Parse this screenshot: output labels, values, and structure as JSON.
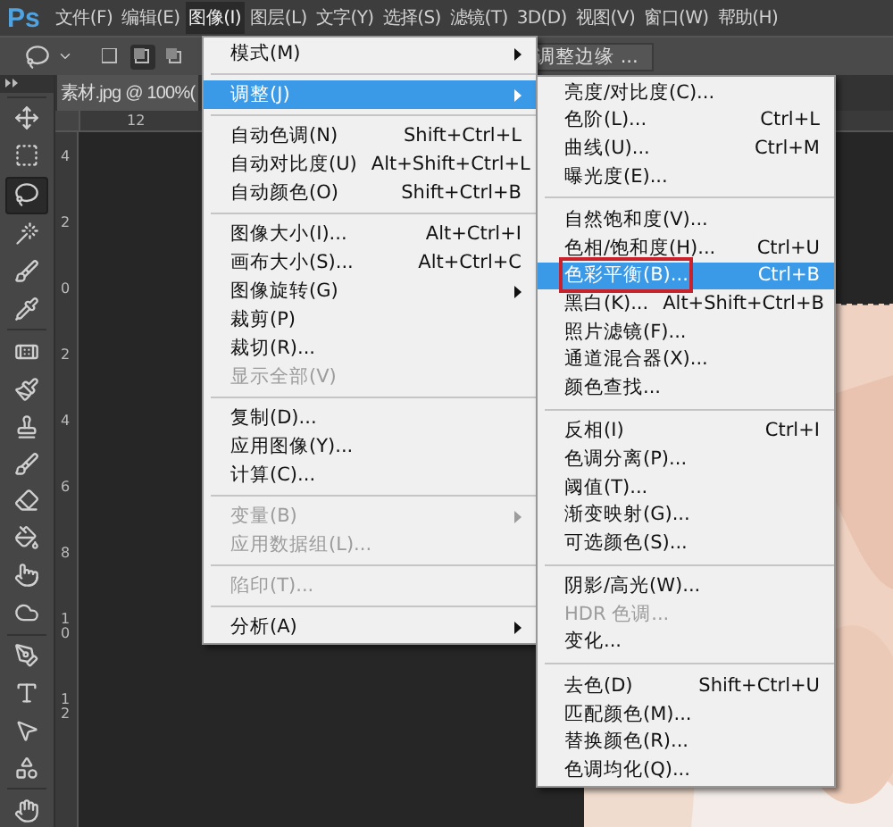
{
  "app_logo": "Ps",
  "menu_bar": [
    {
      "label": "文件(F)",
      "selected": false
    },
    {
      "label": "编辑(E)",
      "selected": false
    },
    {
      "label": "图像(I)",
      "selected": true
    },
    {
      "label": "图层(L)",
      "selected": false
    },
    {
      "label": "文字(Y)",
      "selected": false
    },
    {
      "label": "选择(S)",
      "selected": false
    },
    {
      "label": "滤镜(T)",
      "selected": false
    },
    {
      "label": "3D(D)",
      "selected": false
    },
    {
      "label": "视图(V)",
      "selected": false
    },
    {
      "label": "窗口(W)",
      "selected": false
    },
    {
      "label": "帮助(H)",
      "selected": false
    }
  ],
  "options_bar": {
    "selection_modes": [
      {
        "selected": false
      },
      {
        "selected": true
      },
      {
        "selected": false
      }
    ],
    "refine_edge_button": "调整边缘 ..."
  },
  "document_tab": "素材.jpg @ 100%(",
  "top_ruler": [
    "12"
  ],
  "left_ruler": [
    "4",
    "2",
    "0",
    "2",
    "4",
    "6",
    "8",
    "10",
    "12"
  ],
  "tools": [
    {
      "kind": "move",
      "selected": false
    },
    {
      "kind": "marquee",
      "selected": false
    },
    {
      "kind": "lasso",
      "selected": true
    },
    {
      "kind": "wand",
      "selected": false
    },
    {
      "kind": "quick",
      "selected": false
    },
    {
      "kind": "eyedropper",
      "selected": false
    },
    {
      "kind": "heal",
      "selected": false
    },
    {
      "kind": "brush",
      "selected": false
    },
    {
      "kind": "stamp",
      "selected": false
    },
    {
      "kind": "history",
      "selected": false
    },
    {
      "kind": "eraser",
      "selected": false
    },
    {
      "kind": "bucket",
      "selected": false
    },
    {
      "kind": "smudge",
      "selected": false
    },
    {
      "kind": "sponge",
      "selected": false
    },
    {
      "kind": "pen",
      "selected": false
    },
    {
      "kind": "type",
      "selected": false
    },
    {
      "kind": "path",
      "selected": false
    },
    {
      "kind": "shape",
      "selected": false
    },
    {
      "kind": "hand",
      "selected": false
    }
  ],
  "image_menu": [
    {
      "kind": "item",
      "label": "模式(M)",
      "has_submenu": true,
      "selected": false,
      "disabled": false
    },
    {
      "kind": "separator"
    },
    {
      "kind": "item",
      "label": "调整(J)",
      "has_submenu": true,
      "selected": true,
      "disabled": false
    },
    {
      "kind": "separator"
    },
    {
      "kind": "item",
      "label": "自动色调(N)",
      "shortcut": "Shift+Ctrl+L",
      "selected": false,
      "disabled": false
    },
    {
      "kind": "item",
      "label": "自动对比度(U)",
      "shortcut": "Alt+Shift+Ctrl+L",
      "selected": false,
      "disabled": false
    },
    {
      "kind": "item",
      "label": "自动颜色(O)",
      "shortcut": "Shift+Ctrl+B",
      "selected": false,
      "disabled": false
    },
    {
      "kind": "separator"
    },
    {
      "kind": "item",
      "label": "图像大小(I)...",
      "shortcut": "Alt+Ctrl+I",
      "selected": false,
      "disabled": false
    },
    {
      "kind": "item",
      "label": "画布大小(S)...",
      "shortcut": "Alt+Ctrl+C",
      "selected": false,
      "disabled": false
    },
    {
      "kind": "item",
      "label": "图像旋转(G)",
      "has_submenu": true,
      "selected": false,
      "disabled": false
    },
    {
      "kind": "item",
      "label": "裁剪(P)",
      "selected": false,
      "disabled": false
    },
    {
      "kind": "item",
      "label": "裁切(R)...",
      "selected": false,
      "disabled": false
    },
    {
      "kind": "item",
      "label": "显示全部(V)",
      "selected": false,
      "disabled": true
    },
    {
      "kind": "separator"
    },
    {
      "kind": "item",
      "label": "复制(D)...",
      "selected": false,
      "disabled": false
    },
    {
      "kind": "item",
      "label": "应用图像(Y)...",
      "selected": false,
      "disabled": false
    },
    {
      "kind": "item",
      "label": "计算(C)...",
      "selected": false,
      "disabled": false
    },
    {
      "kind": "separator"
    },
    {
      "kind": "item",
      "label": "变量(B)",
      "has_submenu": true,
      "selected": false,
      "disabled": true
    },
    {
      "kind": "item",
      "label": "应用数据组(L)...",
      "selected": false,
      "disabled": true
    },
    {
      "kind": "separator"
    },
    {
      "kind": "item",
      "label": "陷印(T)...",
      "selected": false,
      "disabled": true
    },
    {
      "kind": "separator"
    },
    {
      "kind": "item",
      "label": "分析(A)",
      "has_submenu": true,
      "selected": false,
      "disabled": false
    }
  ],
  "adjust_submenu": [
    {
      "kind": "item",
      "label": "亮度/对比度(C)...",
      "selected": false,
      "disabled": false
    },
    {
      "kind": "item",
      "label": "色阶(L)...",
      "shortcut": "Ctrl+L",
      "selected": false,
      "disabled": false
    },
    {
      "kind": "item",
      "label": "曲线(U)...",
      "shortcut": "Ctrl+M",
      "selected": false,
      "disabled": false
    },
    {
      "kind": "item",
      "label": "曝光度(E)...",
      "selected": false,
      "disabled": false
    },
    {
      "kind": "separator"
    },
    {
      "kind": "item",
      "label": "自然饱和度(V)...",
      "selected": false,
      "disabled": false
    },
    {
      "kind": "item",
      "label": "色相/饱和度(H)...",
      "shortcut": "Ctrl+U",
      "selected": false,
      "disabled": false
    },
    {
      "kind": "item",
      "label": "色彩平衡(B)...",
      "shortcut": "Ctrl+B",
      "selected": true,
      "disabled": false,
      "outlined": true
    },
    {
      "kind": "item",
      "label": "黑白(K)...",
      "shortcut": "Alt+Shift+Ctrl+B",
      "selected": false,
      "disabled": false
    },
    {
      "kind": "item",
      "label": "照片滤镜(F)...",
      "selected": false,
      "disabled": false
    },
    {
      "kind": "item",
      "label": "通道混合器(X)...",
      "selected": false,
      "disabled": false
    },
    {
      "kind": "item",
      "label": "颜色查找...",
      "selected": false,
      "disabled": false
    },
    {
      "kind": "separator"
    },
    {
      "kind": "item",
      "label": "反相(I)",
      "shortcut": "Ctrl+I",
      "selected": false,
      "disabled": false
    },
    {
      "kind": "item",
      "label": "色调分离(P)...",
      "selected": false,
      "disabled": false
    },
    {
      "kind": "item",
      "label": "阈值(T)...",
      "selected": false,
      "disabled": false
    },
    {
      "kind": "item",
      "label": "渐变映射(G)...",
      "selected": false,
      "disabled": false
    },
    {
      "kind": "item",
      "label": "可选颜色(S)...",
      "selected": false,
      "disabled": false
    },
    {
      "kind": "separator"
    },
    {
      "kind": "item",
      "label": "阴影/高光(W)...",
      "selected": false,
      "disabled": false
    },
    {
      "kind": "item",
      "label": "HDR 色调...",
      "selected": false,
      "disabled": true
    },
    {
      "kind": "item",
      "label": "变化...",
      "selected": false,
      "disabled": false
    },
    {
      "kind": "separator"
    },
    {
      "kind": "item",
      "label": "去色(D)",
      "shortcut": "Shift+Ctrl+U",
      "selected": false,
      "disabled": false
    },
    {
      "kind": "item",
      "label": "匹配颜色(M)...",
      "selected": false,
      "disabled": false
    },
    {
      "kind": "item",
      "label": "替换颜色(R)...",
      "selected": false,
      "disabled": false
    },
    {
      "kind": "item",
      "label": "色调均化(Q)...",
      "selected": false,
      "disabled": false
    }
  ]
}
